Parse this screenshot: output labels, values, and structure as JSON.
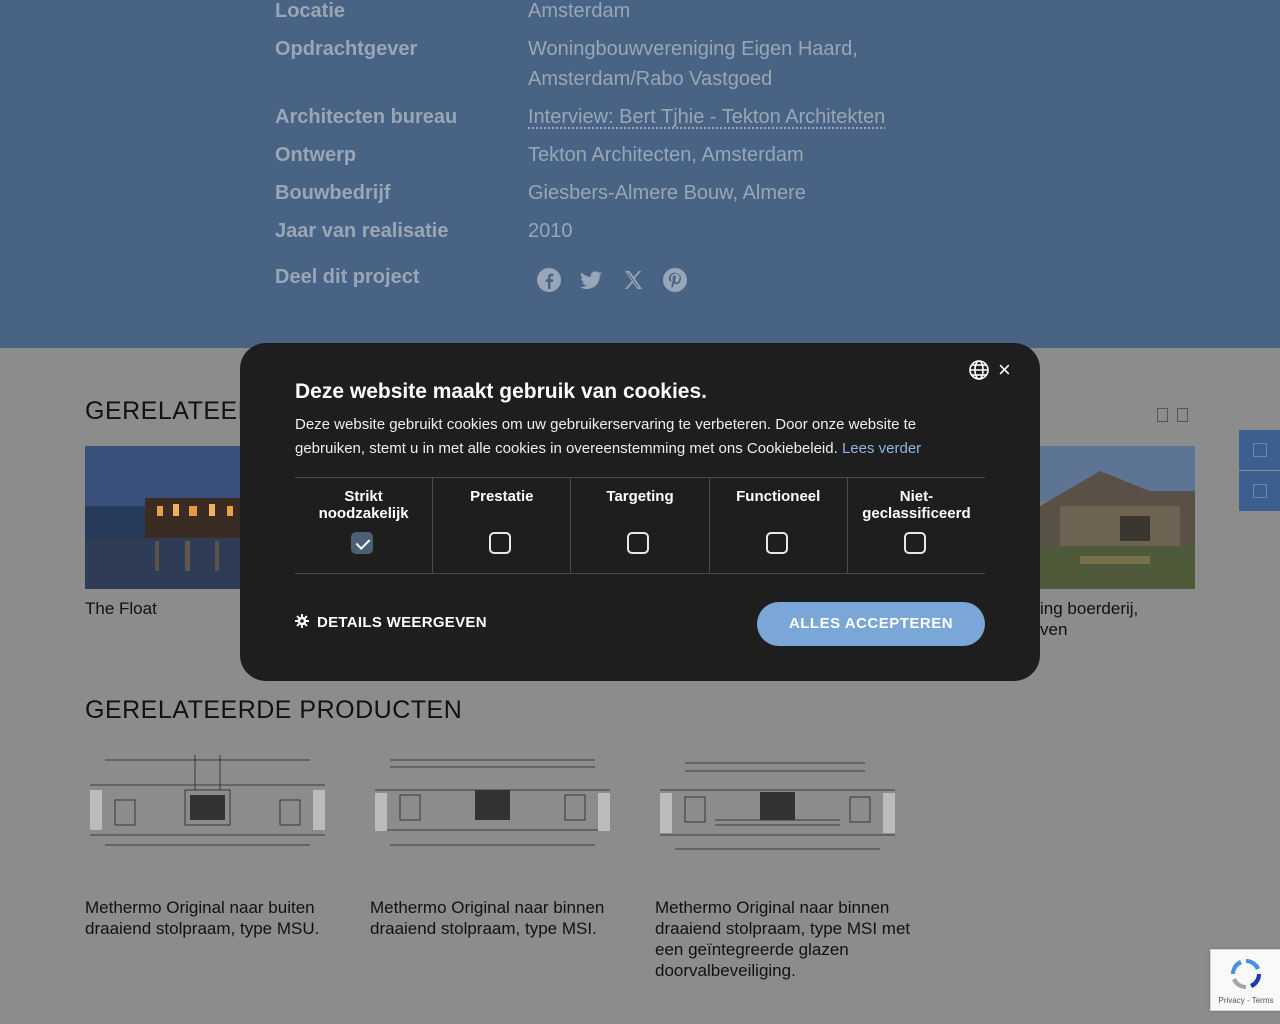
{
  "project": {
    "specs": [
      {
        "label": "Locatie",
        "value": "Amsterdam"
      },
      {
        "label": "Opdrachtgever",
        "value": "Woningbouwvereniging Eigen Haard,",
        "value2": "Amsterdam/Rabo Vastgoed"
      },
      {
        "label": "Architecten bureau",
        "value": "Interview: Bert Tjhie - Tekton Architekten"
      },
      {
        "label": "Ontwerp",
        "value": "Tekton Architecten, Amsterdam"
      },
      {
        "label": "Bouwbedrijf",
        "value": "Giesbers-Almere Bouw, Almere"
      },
      {
        "label": "Jaar van realisatie",
        "value": "2010"
      },
      {
        "label": "Deel dit project"
      }
    ],
    "share_icons": [
      "facebook-icon",
      "twitter-icon",
      "x-icon",
      "pinterest-icon"
    ]
  },
  "related_projects": {
    "title": "GERELATEERDE PROJECTEN",
    "title_visible": "GERELATEER",
    "items": [
      {
        "name": "The Float"
      },
      {
        "name_line1": "ing boerderij,",
        "name_line2": "ven"
      }
    ]
  },
  "related_products": {
    "title": "GERELATEERDE PRODUCTEN",
    "items": [
      {
        "name": "Methermo Original naar buiten draaiend stolpraam, type MSU."
      },
      {
        "name": "Methermo Original naar binnen draaiend stolpraam, type MSI."
      },
      {
        "name": "Methermo Original naar binnen draaiend stolpraam, type MSI met een geïntegreerde glazen doorvalbeveiliging."
      }
    ]
  },
  "cookie_modal": {
    "title": "Deze website maakt gebruik van cookies.",
    "description": "Deze website gebruikt cookies om uw gebruikerservaring te verbeteren. Door onze website te gebruiken, stemt u in met alle cookies in overeenstemming met ons Cookiebeleid.",
    "read_more": "Lees verder",
    "close_label": "×",
    "categories": [
      {
        "label_line1": "Strikt",
        "label_line2": "noodzakelijk",
        "checked": true
      },
      {
        "label_line1": "Prestatie",
        "label_line2": "",
        "checked": false
      },
      {
        "label_line1": "Targeting",
        "label_line2": "",
        "checked": false
      },
      {
        "label_line1": "Functioneel",
        "label_line2": "",
        "checked": false
      },
      {
        "label_line1": "Niet-",
        "label_line2": "geclassificeerd",
        "checked": false
      }
    ],
    "details_label": "DETAILS WEERGEVEN",
    "accept_label": "ALLES ACCEPTEREN"
  },
  "recaptcha": {
    "text": "Privacy - Terms"
  },
  "colors": {
    "header_bg": "#486384",
    "modal_bg": "#1e1e1e",
    "accept_bg": "#7aa6d8",
    "overlay_bg": "#8c8c8c"
  }
}
